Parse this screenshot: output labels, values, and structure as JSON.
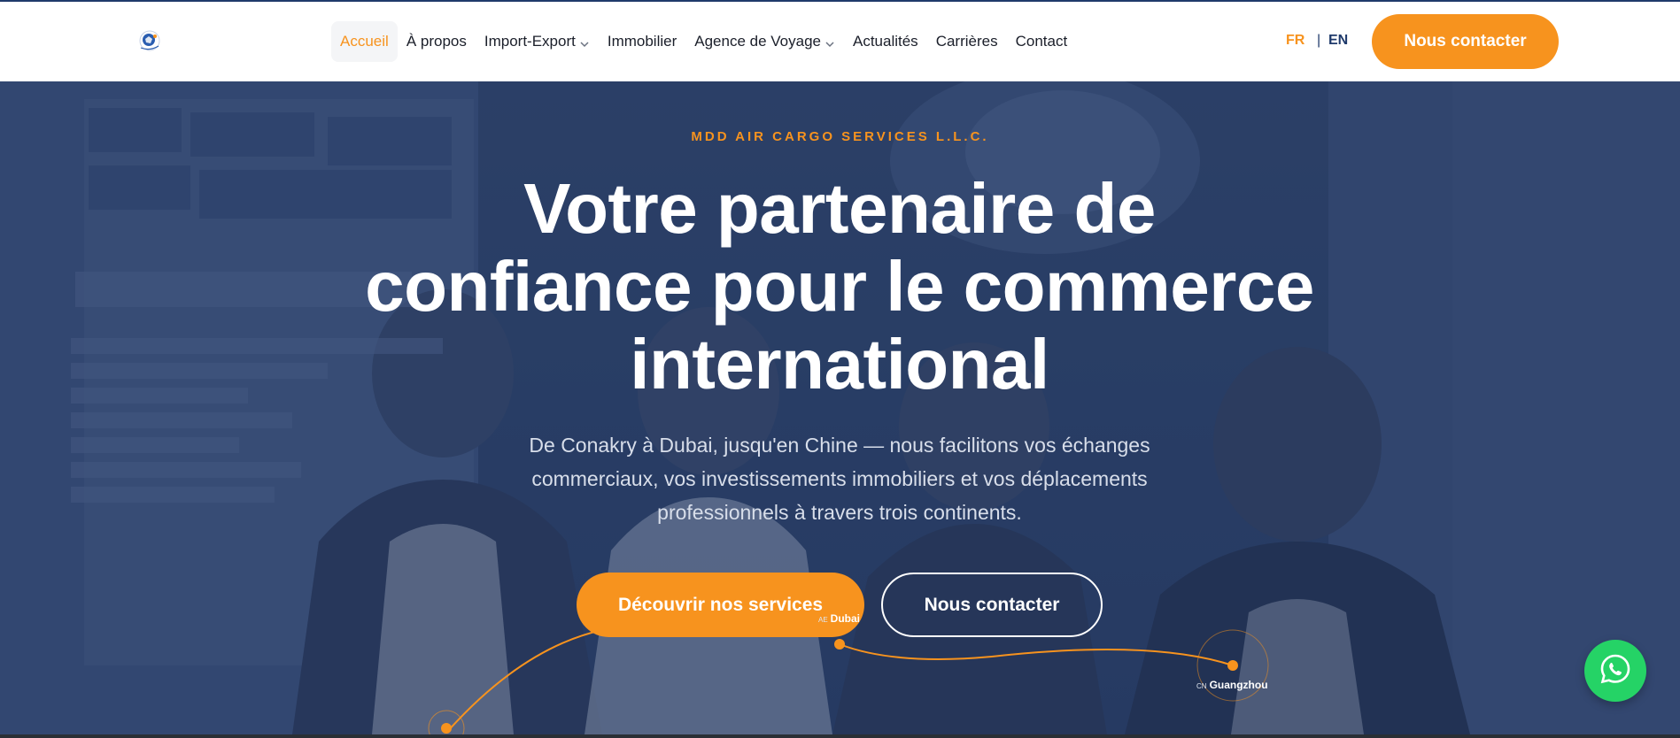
{
  "header": {
    "logo_icon": "company-logo-icon",
    "nav": [
      {
        "label": "Accueil",
        "active": true,
        "dropdown": false
      },
      {
        "label": "À propos",
        "active": false,
        "dropdown": false
      },
      {
        "label": "Import-Export",
        "active": false,
        "dropdown": true
      },
      {
        "label": "Immobilier",
        "active": false,
        "dropdown": false
      },
      {
        "label": "Agence de Voyage",
        "active": false,
        "dropdown": true
      },
      {
        "label": "Actualités",
        "active": false,
        "dropdown": false
      },
      {
        "label": "Carrières",
        "active": false,
        "dropdown": false
      },
      {
        "label": "Contact",
        "active": false,
        "dropdown": false
      }
    ],
    "lang_fr": "FR",
    "lang_sep": "|",
    "lang_en": "EN",
    "cta_label": "Nous contacter"
  },
  "hero": {
    "eyebrow": "MDD AIR CARGO SERVICES L.L.C.",
    "title": "Votre partenaire de confiance pour le commerce international",
    "subtitle": "De Conakry à Dubai, jusqu'en Chine — nous facilitons vos échanges commerciaux, vos investissements immobiliers et vos déplacements professionnels à travers trois continents.",
    "primary_cta": "Découvrir nos services",
    "secondary_cta": "Nous contacter",
    "route": {
      "dubai_code": "AE",
      "dubai_label": "Dubai",
      "gz_code": "CN",
      "gz_label": "Guangzhou"
    }
  },
  "colors": {
    "accent": "#f7931e",
    "brand_navy": "#1f3a6b",
    "whatsapp": "#25d366"
  },
  "icons": {
    "chevron": "chevron-down-icon",
    "whatsapp": "whatsapp-icon"
  }
}
